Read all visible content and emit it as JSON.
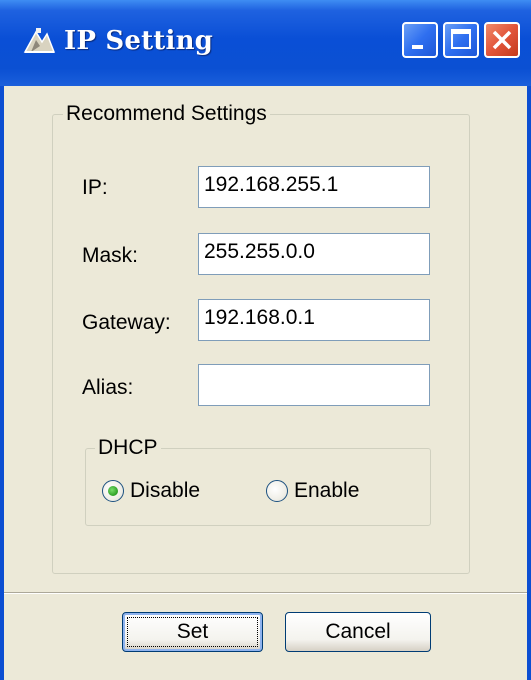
{
  "window": {
    "title": "IP Setting",
    "title_icon": "network-setup-icon",
    "controls": {
      "minimize": "minimize-icon",
      "maximize": "maximize-icon",
      "close": "close-icon"
    }
  },
  "recommend": {
    "group_title": "Recommend Settings",
    "fields": {
      "ip": {
        "label": "IP:",
        "value": "192.168.255.1"
      },
      "mask": {
        "label": "Mask:",
        "value": "255.255.0.0"
      },
      "gateway": {
        "label": "Gateway:",
        "value": "192.168.0.1"
      },
      "alias": {
        "label": "Alias:",
        "value": ""
      }
    }
  },
  "dhcp": {
    "group_title": "DHCP",
    "options": [
      {
        "label": "Disable",
        "selected": true
      },
      {
        "label": "Enable",
        "selected": false
      }
    ]
  },
  "buttons": {
    "set": "Set",
    "cancel": "Cancel"
  },
  "colors": {
    "titlebar": "#0A4FD6",
    "dialog_bg": "#ECE9D8",
    "close_button": "#E2553A",
    "radio_selected": "#2B9E24"
  }
}
